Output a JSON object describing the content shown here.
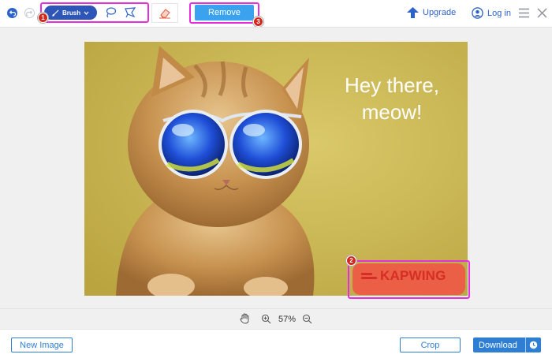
{
  "toolbar": {
    "brush_label": "Brush",
    "remove_label": "Remove",
    "upgrade_label": "Upgrade",
    "login_label": "Log in",
    "icons": [
      "undo-icon",
      "redo-icon",
      "brush-icon",
      "chevron-down-icon",
      "lasso-icon",
      "polygon-lasso-icon",
      "eraser-icon",
      "upgrade-icon",
      "user-icon",
      "menu-icon",
      "close-icon"
    ]
  },
  "badges": {
    "b1": "1",
    "b2": "2",
    "b3": "3"
  },
  "canvas": {
    "caption_line1": "Hey there,",
    "caption_line2": "meow!",
    "watermark_text": "KAPWING"
  },
  "zoom": {
    "value": "57%"
  },
  "footer": {
    "new_image_label": "New Image",
    "crop_label": "Crop",
    "download_label": "Download"
  },
  "colors": {
    "accent_blue": "#2e63c9",
    "remove_blue": "#3aa2ee",
    "highlight_magenta": "#e62ee0",
    "badge_red": "#d4281c",
    "watermark_red": "#ec5b46"
  }
}
